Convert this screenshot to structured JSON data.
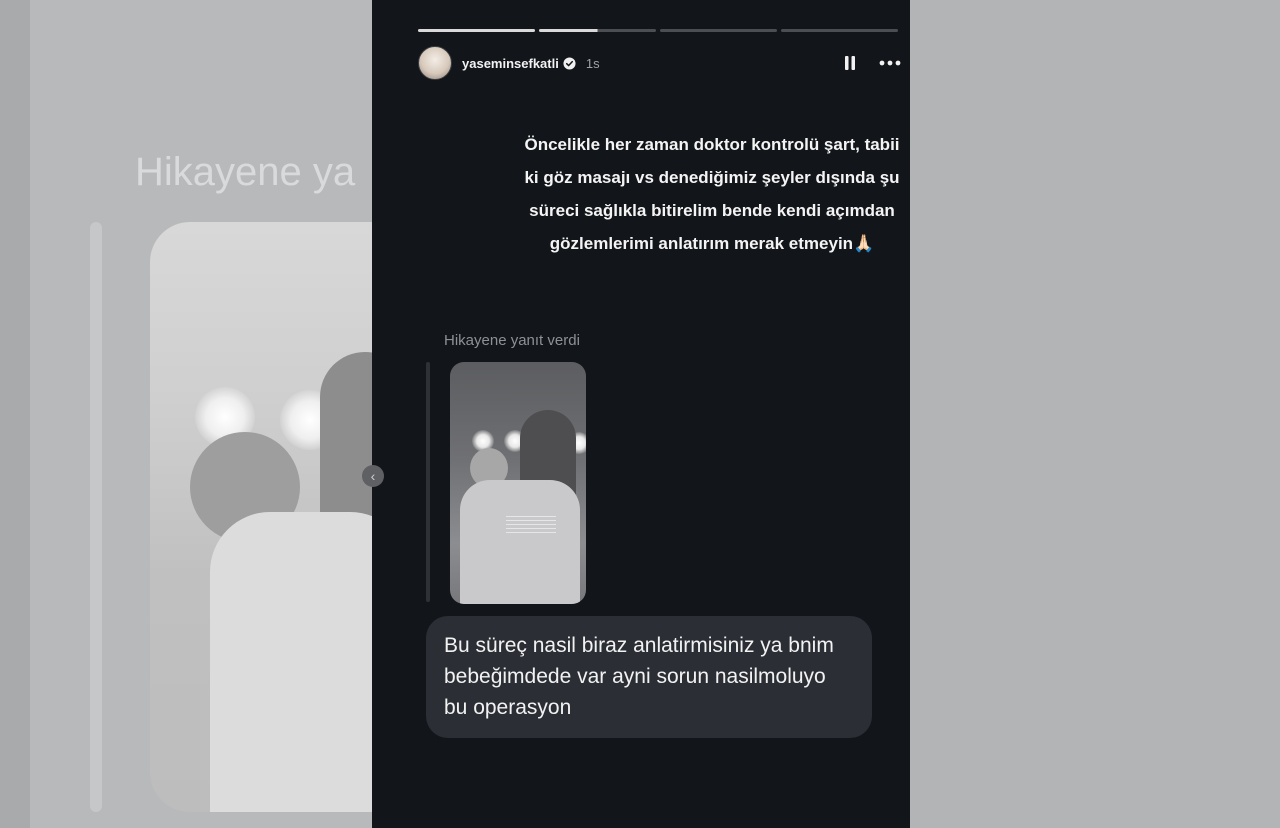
{
  "background": {
    "reply_label_echo": "Hikayene ya"
  },
  "story": {
    "progress_segments": [
      {
        "state": "done"
      },
      {
        "state": "partial",
        "fraction": 0.5
      },
      {
        "state": "pending"
      },
      {
        "state": "pending"
      }
    ],
    "header": {
      "username": "yaseminsefkatli",
      "verified": true,
      "time": "1s",
      "pause_icon": "pause-icon",
      "more_icon": "more-horizontal-icon"
    },
    "caption": "Öncelikle her zaman doktor kontrolü şart, tabii ki göz masajı vs denediğimiz şeyler dışında şu süreci sağlıkla bitirelim bende kendi açımdan gözlemlerimi anlatırım merak etmeyin🙏🏻",
    "reply": {
      "label": "Hikayene yanıt verdi",
      "message": "Bu süreç nasil biraz anlatirmisiniz ya bnim bebeğimdede var ayni sorun nasilmoluyo bu operasyon"
    }
  },
  "colors": {
    "story_bg": "#121519",
    "bubble_bg": "#2b2f35",
    "verified_blue": "#3897f0"
  }
}
